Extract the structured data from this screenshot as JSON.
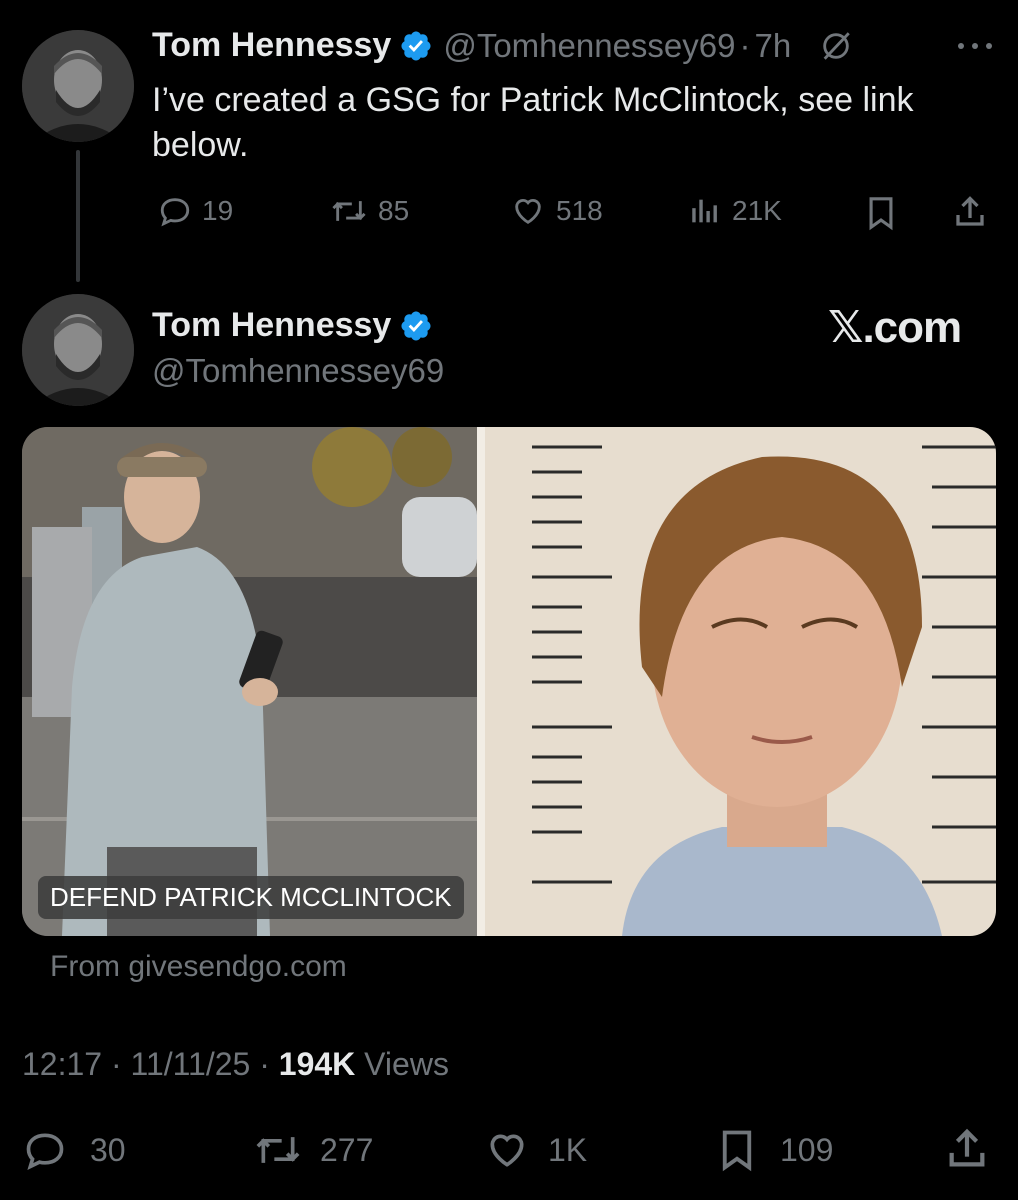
{
  "reply_tweet": {
    "author_name": "Tom Hennessy",
    "handle": "@Tomhennessey69",
    "separator": "·",
    "time": "7h",
    "text": "I’ve created a GSG for Patrick McClintock, see link below.",
    "stats": {
      "replies": "19",
      "reposts": "85",
      "likes": "518",
      "views": "21K"
    }
  },
  "quoted_tweet": {
    "author_name": "Tom Hennessy",
    "handle": "@Tomhennessey69",
    "brand": "𝕏.com",
    "card": {
      "caption": "DEFEND PATRICK MCCLINTOCK",
      "source": "From givesendgo.com"
    },
    "meta": {
      "time": "12:17",
      "separator": "·",
      "date": "11/11/25",
      "views_count": "194K",
      "views_label": "Views"
    },
    "stats": {
      "replies": "30",
      "reposts": "277",
      "likes": "1K",
      "bookmarks": "109"
    }
  },
  "colors": {
    "background": "#000000",
    "text_primary": "#e7e9ea",
    "text_secondary": "#71767b",
    "verified_blue": "#1d9bf0"
  },
  "icons": [
    "reply-icon",
    "repost-icon",
    "like-icon",
    "views-icon",
    "bookmark-icon",
    "share-icon",
    "grok-icon",
    "more-icon",
    "verified-icon"
  ]
}
